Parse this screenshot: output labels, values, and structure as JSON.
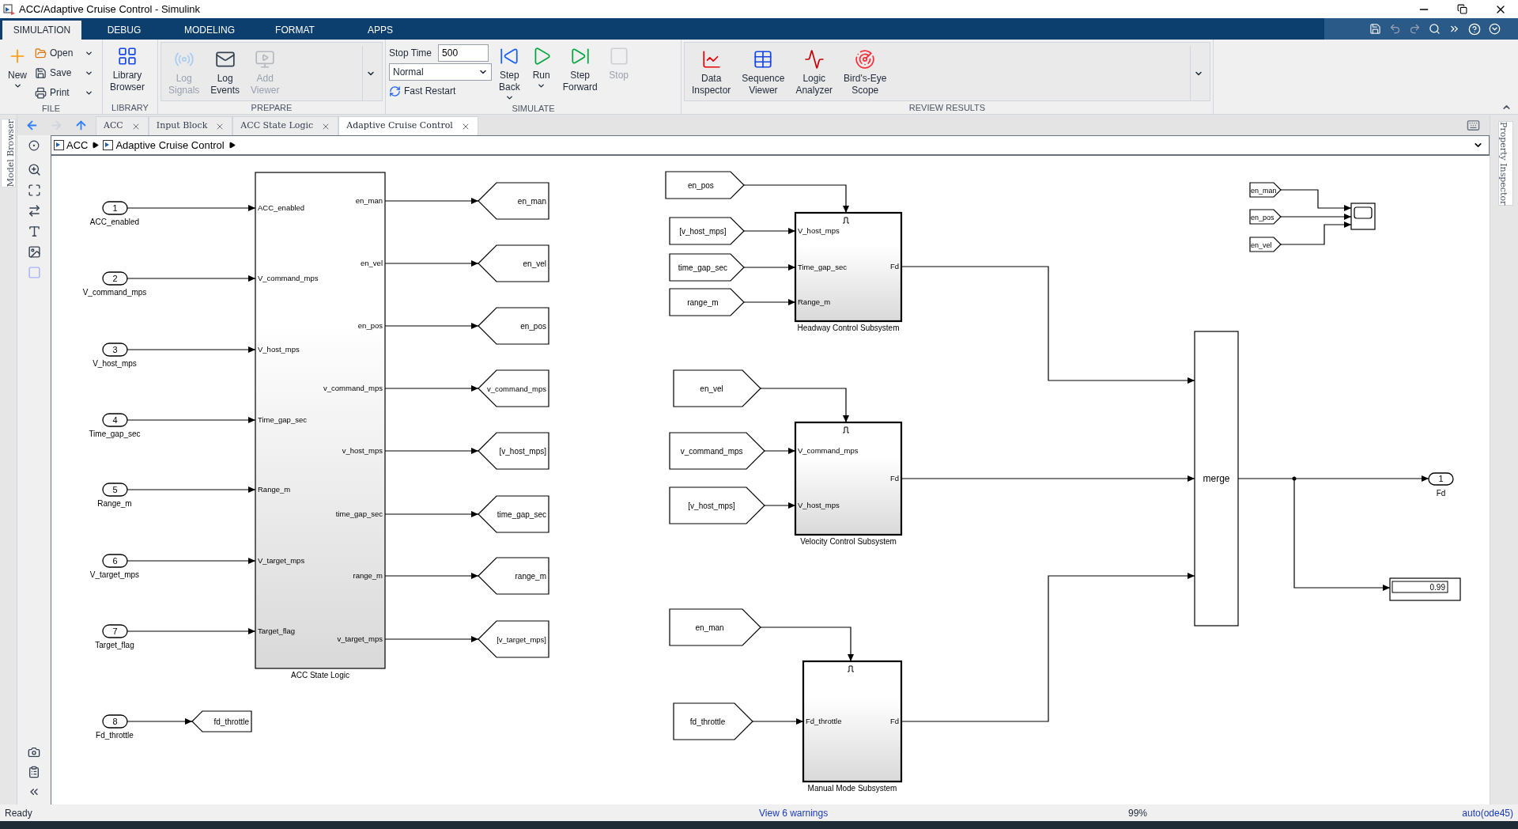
{
  "window": {
    "title": "ACC/Adaptive Cruise Control - Simulink"
  },
  "ribbon_tabs": [
    {
      "label": "SIMULATION",
      "selected": true
    },
    {
      "label": "DEBUG",
      "selected": false
    },
    {
      "label": "MODELING",
      "selected": false
    },
    {
      "label": "FORMAT",
      "selected": false
    },
    {
      "label": "APPS",
      "selected": false
    }
  ],
  "ribbon_groups": [
    {
      "title": "FILE",
      "gallery": false,
      "items": [
        {
          "kind": "large",
          "label": "New",
          "dropdown": true,
          "disabled": false
        },
        {
          "kind": "small",
          "label": "Open",
          "dropdown": true,
          "disabled": false
        },
        {
          "kind": "small",
          "label": "Save",
          "dropdown": true,
          "disabled": false
        },
        {
          "kind": "small",
          "label": "Print",
          "dropdown": true,
          "disabled": false
        }
      ]
    },
    {
      "title": "LIBRARY",
      "gallery": false,
      "items": [
        {
          "kind": "large",
          "label": "Library\nBrowser",
          "dropdown": false,
          "disabled": false
        }
      ]
    },
    {
      "title": "PREPARE",
      "gallery": true,
      "items": [
        {
          "kind": "large",
          "label": "Log\nSignals",
          "dropdown": false,
          "disabled": true
        },
        {
          "kind": "large",
          "label": "Log\nEvents",
          "dropdown": false,
          "disabled": false
        },
        {
          "kind": "large",
          "label": "Add\nViewer",
          "dropdown": false,
          "disabled": true
        }
      ]
    },
    {
      "title": "SIMULATE",
      "gallery": false,
      "items": [
        {
          "kind": "field",
          "label": "Stop Time",
          "value": "500",
          "disabled": false
        },
        {
          "kind": "select",
          "value": "Normal",
          "disabled": false
        },
        {
          "kind": "toggle",
          "label": "Fast Restart",
          "disabled": false
        },
        {
          "kind": "large",
          "label": "Step\nBack",
          "dropdown": true,
          "disabled": false
        },
        {
          "kind": "large",
          "label": "Run",
          "dropdown": true,
          "disabled": false
        },
        {
          "kind": "large",
          "label": "Step\nForward",
          "dropdown": false,
          "disabled": false
        },
        {
          "kind": "large",
          "label": "Stop",
          "dropdown": false,
          "disabled": true
        }
      ]
    },
    {
      "title": "REVIEW RESULTS",
      "gallery": true,
      "items": [
        {
          "kind": "large",
          "label": "Data\nInspector",
          "dropdown": false,
          "disabled": false
        },
        {
          "kind": "large",
          "label": "Sequence\nViewer",
          "dropdown": false,
          "disabled": false
        },
        {
          "kind": "large",
          "label": "Logic\nAnalyzer",
          "dropdown": false,
          "disabled": false
        },
        {
          "kind": "large",
          "label": "Bird's-Eye\nScope",
          "dropdown": false,
          "disabled": false
        }
      ]
    }
  ],
  "side_panels": {
    "left": "Model Browser",
    "right": "Property Inspector"
  },
  "editor_tabs": [
    {
      "label": "ACC",
      "selected": false
    },
    {
      "label": "Input Block",
      "selected": false
    },
    {
      "label": "ACC State Logic",
      "selected": false
    },
    {
      "label": "Adaptive Cruise Control",
      "selected": true
    }
  ],
  "breadcrumb": [
    "ACC",
    "Adaptive Cruise Control"
  ],
  "diagram": {
    "inports": [
      {
        "number": "1",
        "name": "ACC_enabled"
      },
      {
        "number": "2",
        "name": "V_command_mps"
      },
      {
        "number": "3",
        "name": "V_host_mps"
      },
      {
        "number": "4",
        "name": "Time_gap_sec"
      },
      {
        "number": "5",
        "name": "Range_m"
      },
      {
        "number": "6",
        "name": "V_target_mps"
      },
      {
        "number": "7",
        "name": "Target_flag"
      },
      {
        "number": "8",
        "name": "Fd_throttle"
      }
    ],
    "subsystems": [
      {
        "name": "ACC State Logic",
        "triggered": false,
        "inputs": [
          "ACC_enabled",
          "V_command_mps",
          "V_host_mps",
          "Time_gap_sec",
          "Range_m",
          "V_target_mps",
          "Target_flag"
        ],
        "outputs": [
          "en_man",
          "en_vel",
          "en_pos",
          "v_command_mps",
          "v_host_mps",
          "time_gap_sec",
          "range_m",
          "v_target_mps"
        ]
      },
      {
        "name": "Headway Control Subsystem",
        "triggered": true,
        "inputs": [
          "V_host_mps",
          "Time_gap_sec",
          "Range_m"
        ],
        "outputs": [
          "Fd"
        ]
      },
      {
        "name": "Velocity Control Subsystem",
        "triggered": true,
        "inputs": [
          "V_command_mps",
          "V_host_mps"
        ],
        "outputs": [
          "Fd"
        ]
      },
      {
        "name": "Manual Mode Subsystem",
        "triggered": true,
        "inputs": [
          "Fd_throttle"
        ],
        "outputs": [
          "Fd"
        ]
      }
    ],
    "goto_tags": [
      "en_man",
      "en_vel",
      "en_pos",
      "v_command_mps",
      "[v_host_mps]",
      "time_gap_sec",
      "range_m",
      "[v_target_mps]",
      "fd_throttle"
    ],
    "from_tags": [
      "en_pos",
      "[v_host_mps]",
      "time_gap_sec",
      "range_m",
      "en_vel",
      "v_command_mps",
      "[v_host_mps]",
      "en_man",
      "fd_throttle",
      "en_man",
      "en_pos",
      "en_vel"
    ],
    "merge": {
      "label": "merge"
    },
    "outport": {
      "number": "1",
      "name": "Fd"
    },
    "display": {
      "value": "0.99"
    }
  },
  "status_bar": {
    "status": "Ready",
    "warnings": "View 6 warnings",
    "zoom": "99%",
    "solver": "auto(ode45)"
  }
}
